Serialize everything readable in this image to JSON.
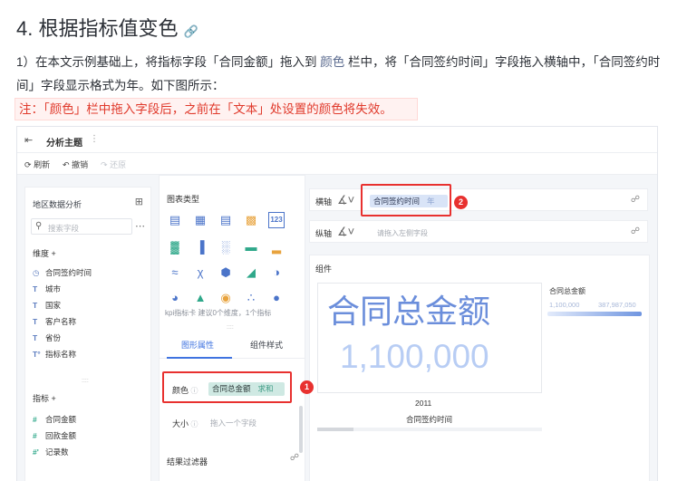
{
  "doc": {
    "title": "4. 根据指标值变色",
    "anchor_icon": "link-icon",
    "para_part1": "1）在本文示例基础上，将指标字段「合同金额」拖入到",
    "para_highlight": "颜色",
    "para_part2": "栏中，将「合同签约时间」字段拖入横轴中，「合同签约时间」字段显示格式为年。如下图所示：",
    "note": "注：「颜色」栏中拖入字段后，之前在「文本」处设置的颜色将失效。"
  },
  "app": {
    "subject": "分析主题",
    "more": "⋮",
    "toolbar": {
      "refresh": "刷新",
      "undo": "撤销",
      "redo": "还原"
    },
    "left": {
      "dataset": "地区数据分析",
      "search_placeholder": "搜索字段",
      "dimension_title": "维度",
      "dimensions": [
        "合同签约时间",
        "城市",
        "国家",
        "客户名称",
        "省份",
        "指标名称"
      ],
      "measure_title": "指标",
      "measures": [
        "合同金额",
        "回款金额",
        "记录数"
      ]
    },
    "mid": {
      "chart_types_title": "图表类型",
      "kpi_hint": "kpi指标卡 建议0个维度，1个指标",
      "tab_graph": "图形属性",
      "tab_component": "组件样式",
      "color_label": "颜色",
      "color_field": "合同总金额",
      "color_agg": "求和",
      "size_label": "大小",
      "size_placeholder": "拖入一个字段",
      "filter_title": "结果过滤器"
    },
    "right": {
      "x_label": "横轴",
      "x_field": "合同签约时间",
      "x_granularity": "年",
      "y_label": "纵轴",
      "y_placeholder": "请拖入左侧字段",
      "component_title": "组件",
      "card_label": "合同总金额",
      "card_value": "1,100,000",
      "legend_title": "合同总金额",
      "legend_min": "1,100,000",
      "legend_max": "387,987,050",
      "category": "2011",
      "x_axis_title": "合同签约时间"
    },
    "badges": [
      "1",
      "2"
    ]
  },
  "colors": {
    "accent": "#3f73e0",
    "annotation": "#e8312f",
    "kpi_text": "#6b8edb"
  }
}
